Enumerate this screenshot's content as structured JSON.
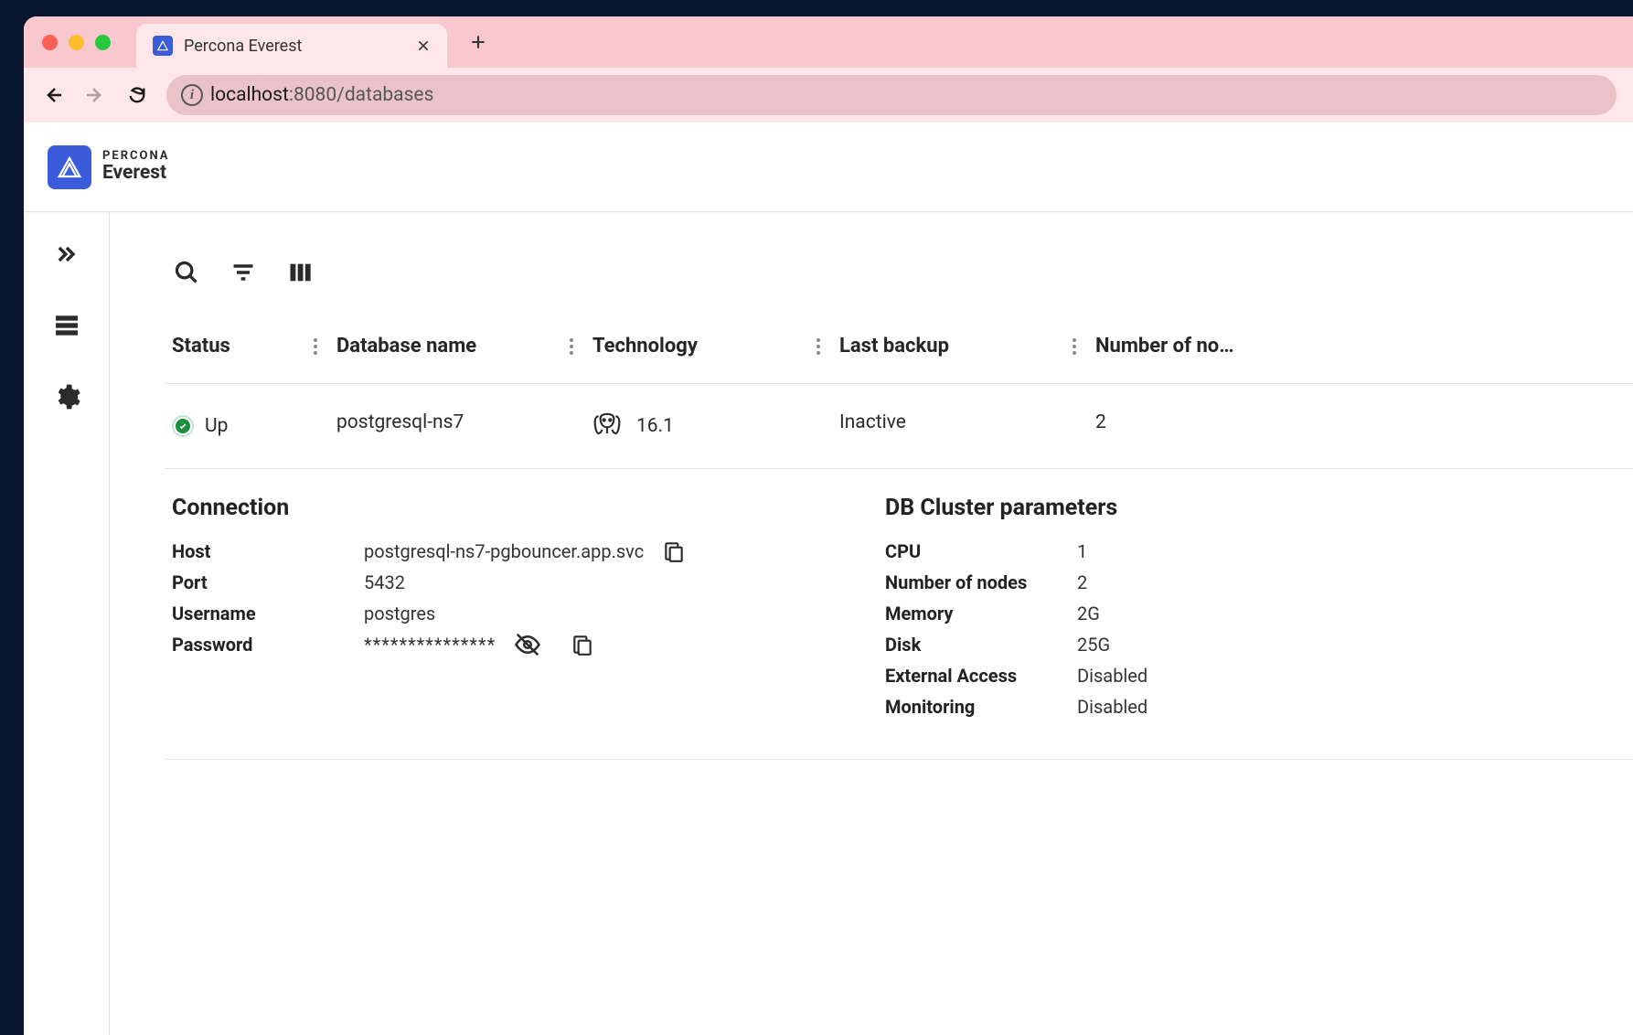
{
  "browser": {
    "tab_title": "Percona Everest",
    "url_host": "localhost",
    "url_path": ":8080/databases"
  },
  "brand": {
    "line1": "PERCONA",
    "line2": "Everest"
  },
  "table": {
    "headers": {
      "status": "Status",
      "name": "Database name",
      "tech": "Technology",
      "backup": "Last backup",
      "nodes": "Number of no…"
    },
    "rows": [
      {
        "status": "Up",
        "name": "postgresql-ns7",
        "tech": "16.1",
        "backup": "Inactive",
        "nodes": "2"
      }
    ]
  },
  "details": {
    "connection_title": "Connection",
    "cluster_title": "DB Cluster parameters",
    "connection": {
      "host_label": "Host",
      "host_value": "postgresql-ns7-pgbouncer.app.svc",
      "port_label": "Port",
      "port_value": "5432",
      "user_label": "Username",
      "user_value": "postgres",
      "pass_label": "Password",
      "pass_value": "***************"
    },
    "cluster": {
      "cpu_label": "CPU",
      "cpu_value": "1",
      "nodes_label": "Number of nodes",
      "nodes_value": "2",
      "mem_label": "Memory",
      "mem_value": "2G",
      "disk_label": "Disk",
      "disk_value": "25G",
      "ext_label": "External Access",
      "ext_value": "Disabled",
      "mon_label": "Monitoring",
      "mon_value": "Disabled"
    }
  }
}
